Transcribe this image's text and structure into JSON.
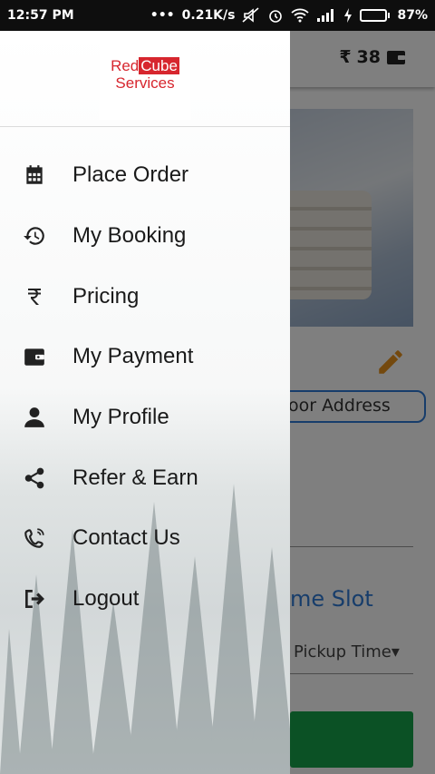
{
  "status_bar": {
    "time": "12:57 PM",
    "network_speed": "0.21K/s",
    "battery_percent": "87%",
    "battery_level": 0.87
  },
  "app_bar": {
    "currency_symbol": "₹",
    "wallet_balance": "38"
  },
  "background": {
    "address_field_text": "Doorstep Address",
    "address_field_visible": "oor Address",
    "time_slot_visible": "me Slot",
    "pickup_visible": "Pickup Time▾"
  },
  "drawer": {
    "logo": {
      "line1_a": "Red",
      "line1_b": "Cube",
      "line2": "Services"
    },
    "items": [
      {
        "label": "Place Order",
        "icon": "calendar-icon"
      },
      {
        "label": "My Booking",
        "icon": "history-icon"
      },
      {
        "label": "Pricing",
        "icon": "rupee-icon"
      },
      {
        "label": "My Payment",
        "icon": "wallet-icon"
      },
      {
        "label": "My Profile",
        "icon": "person-icon"
      },
      {
        "label": "Refer & Earn",
        "icon": "share-icon"
      },
      {
        "label": "Contact Us",
        "icon": "phone-ring-icon"
      },
      {
        "label": "Logout",
        "icon": "logout-icon"
      }
    ]
  },
  "colors": {
    "accent_blue": "#2e7bd6",
    "brand_red": "#d7262e",
    "action_green": "#16a34a",
    "pencil_orange": "#e8921c"
  }
}
